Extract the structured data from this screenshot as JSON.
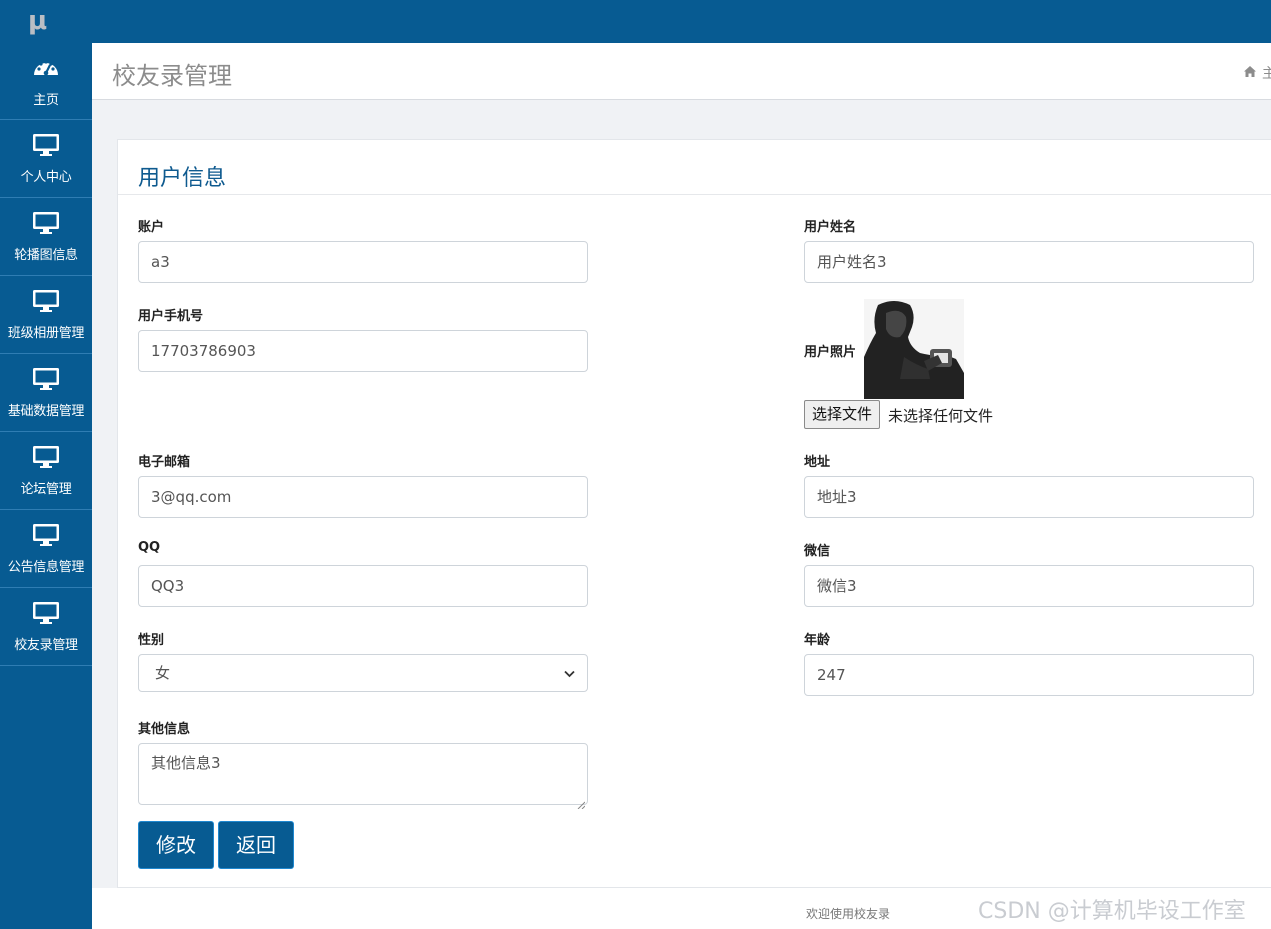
{
  "app": {
    "logo_text": "μ"
  },
  "sidebar": {
    "items": [
      {
        "label": "主页",
        "icon": "dashboard-icon"
      },
      {
        "label": "个人中心",
        "icon": "monitor-icon"
      },
      {
        "label": "轮播图信息",
        "icon": "monitor-icon"
      },
      {
        "label": "班级相册管理",
        "icon": "monitor-icon"
      },
      {
        "label": "基础数据管理",
        "icon": "monitor-icon"
      },
      {
        "label": "论坛管理",
        "icon": "monitor-icon"
      },
      {
        "label": "公告信息管理",
        "icon": "monitor-icon"
      },
      {
        "label": "校友录管理",
        "icon": "monitor-icon"
      }
    ]
  },
  "header": {
    "title": "校友录管理",
    "breadcrumb_home": "主"
  },
  "panel": {
    "title": "用户信息"
  },
  "form": {
    "account": {
      "label": "账户",
      "value": "a3"
    },
    "name": {
      "label": "用户姓名",
      "value": "用户姓名3"
    },
    "phone": {
      "label": "用户手机号",
      "value": "17703786903"
    },
    "photo": {
      "label": "用户照片",
      "choose_button": "选择文件",
      "file_status": "未选择任何文件"
    },
    "email": {
      "label": "电子邮箱",
      "value": "3@qq.com"
    },
    "address": {
      "label": "地址",
      "value": "地址3"
    },
    "qq": {
      "label": "QQ",
      "value": "QQ3"
    },
    "wechat": {
      "label": "微信",
      "value": "微信3"
    },
    "gender": {
      "label": "性别",
      "value": "女"
    },
    "age": {
      "label": "年龄",
      "value": "247"
    },
    "other": {
      "label": "其他信息",
      "value": "其他信息3"
    }
  },
  "buttons": {
    "edit": "修改",
    "back": "返回"
  },
  "footer": {
    "text": "欢迎使用校友录"
  },
  "watermark": "CSDN @计算机毕设工作室",
  "colors": {
    "primary": "#075b92",
    "panel_title": "#0e5a8f",
    "background": "#f0f2f5"
  }
}
